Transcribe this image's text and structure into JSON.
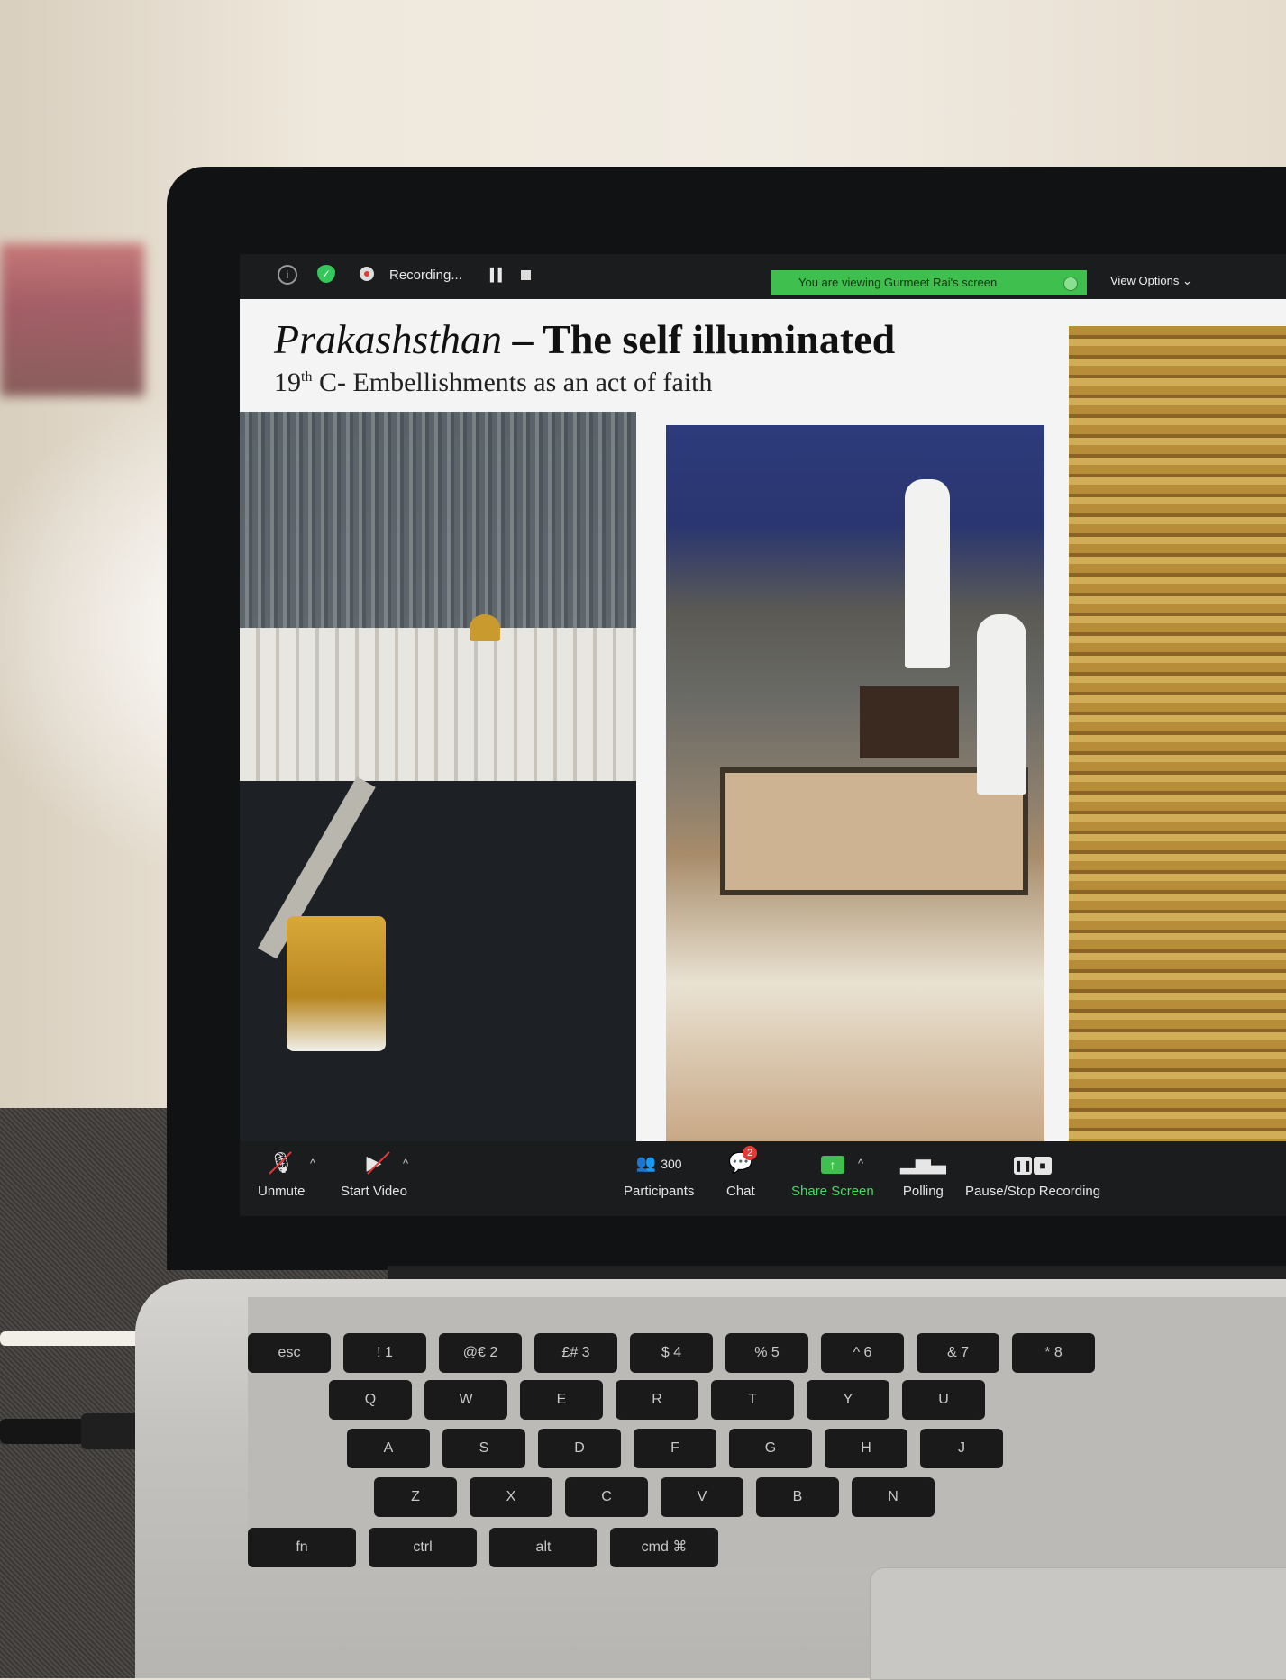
{
  "zoom": {
    "topbar": {
      "recording_label": "Recording...",
      "viewing_banner": "You are viewing Gurmeet Rai's screen",
      "view_options": "View Options ⌄"
    },
    "slide": {
      "title_italic": "Prakashsthan",
      "title_rest": " – The self illuminated",
      "subtitle_sup": "th",
      "subtitle_prefix": "19",
      "subtitle_rest": " C- Embellishments as an act of faith"
    },
    "toolbar": {
      "unmute": "Unmute",
      "start_video": "Start Video",
      "participants_count": "300",
      "participants": "Participants",
      "chat_badge": "2",
      "chat": "Chat",
      "share_screen": "Share Screen",
      "polling": "Polling",
      "pause_stop": "Pause/Stop Recording"
    }
  },
  "keyboard": {
    "keys": [
      "esc",
      "!\n1",
      "@€\n2",
      "£#\n3",
      "$\n4",
      "%\n5",
      "^\n6",
      "&\n7",
      "*\n8",
      "Q",
      "W",
      "E",
      "R",
      "T",
      "Y",
      "U",
      "A",
      "S",
      "D",
      "F",
      "G",
      "H",
      "J",
      "Z",
      "X",
      "C",
      "V",
      "B",
      "N",
      "fn",
      "ctrl",
      "alt",
      "cmd ⌘"
    ]
  },
  "colors": {
    "share_green": "#3fbf4d",
    "record_red": "#e53935"
  }
}
